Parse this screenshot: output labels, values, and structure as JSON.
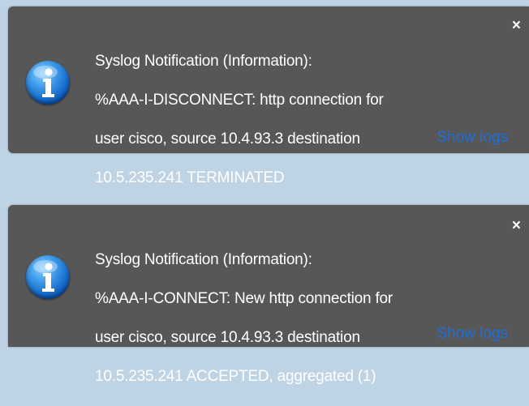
{
  "notifications": [
    {
      "title": "Syslog Notification (Information):",
      "message_lines": [
        "%AAA-I-DISCONNECT: http connection for",
        "user cisco, source 10.4.93.3 destination",
        "10.5.235.241 TERMINATED"
      ],
      "close_label": "×",
      "link_label": "Show logs",
      "icon": "info-icon"
    },
    {
      "title": "Syslog Notification (Information):",
      "message_lines": [
        "%AAA-I-CONNECT: New http connection for",
        "user cisco, source 10.4.93.3 destination",
        "10.5.235.241 ACCEPTED, aggregated (1)"
      ],
      "close_label": "×",
      "link_label": "Show logs",
      "icon": "info-icon"
    }
  ],
  "colors": {
    "background": "#bed3e4",
    "toast_background": "#575757",
    "text": "#ffffff",
    "link": "#1e6fd9",
    "icon_blue": "#1566c8"
  }
}
